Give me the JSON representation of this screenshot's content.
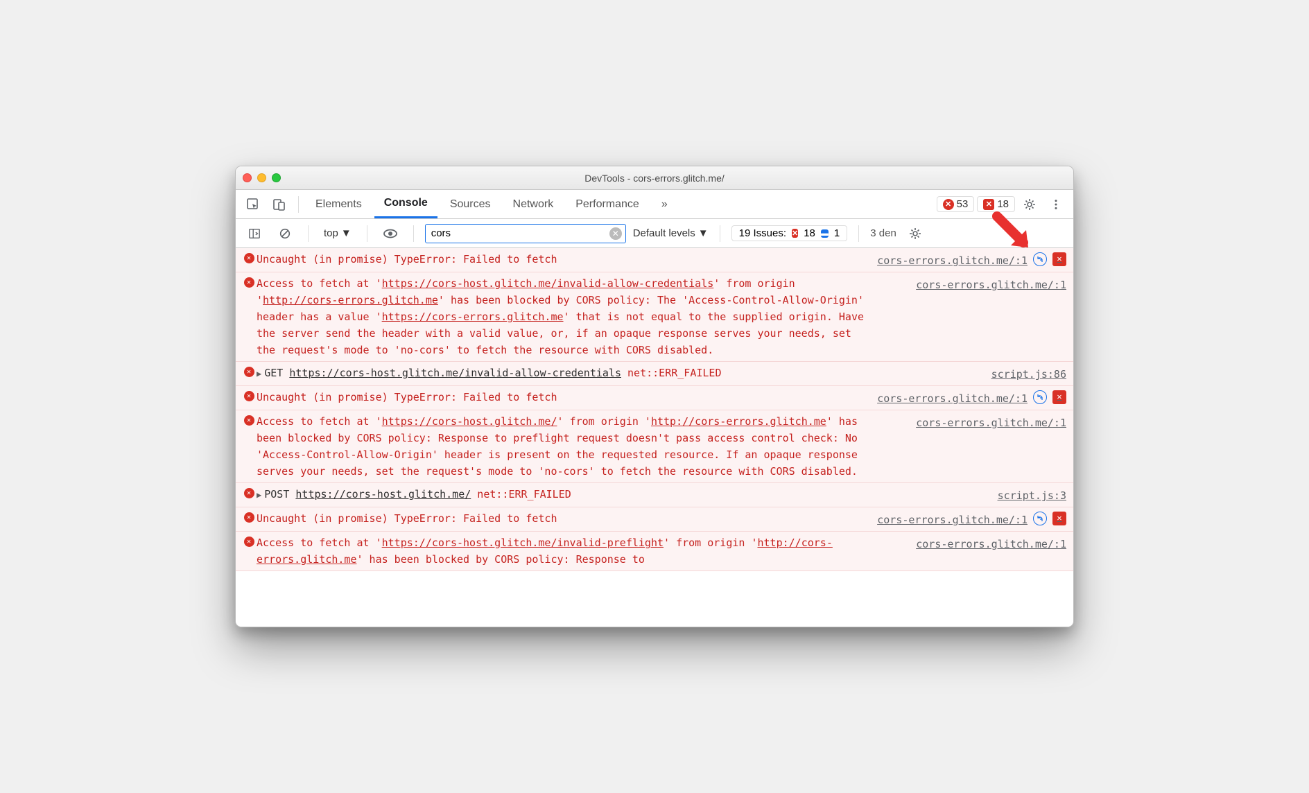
{
  "window": {
    "title": "DevTools - cors-errors.glitch.me/"
  },
  "tabs": {
    "items": [
      "Elements",
      "Console",
      "Sources",
      "Network",
      "Performance"
    ],
    "more": "»",
    "error_count": "53",
    "issue_count": "18"
  },
  "filter": {
    "context": "top",
    "value": "cors",
    "levels": "Default levels",
    "issues_label": "19 Issues:",
    "issues_errors": "18",
    "issues_info": "1",
    "hidden": "3      den"
  },
  "messages": [
    {
      "type": "simple",
      "text": "Uncaught (in promise) TypeError: Failed to fetch",
      "source": "cors-errors.glitch.me/:1",
      "has_net_icon": true,
      "has_issue_icon": true
    },
    {
      "type": "cors",
      "prefix": "Access to fetch at '",
      "url": "https://cors-host.glitch.me/invalid-allow-credentials",
      "mid": "' from origin '",
      "origin": "http://cors-errors.glitch.me",
      "rest": "' has been blocked by CORS policy: The 'Access-Control-Allow-Origin' header has a value '",
      "url2": "https://cors-errors.glitch.me",
      "tail": "' that is not equal to the supplied origin. Have the server send the header with a valid value, or, if an opaque response serves your needs, set the request's mode to 'no-cors' to fetch the resource with CORS disabled.",
      "source": "cors-errors.glitch.me/:1"
    },
    {
      "type": "request",
      "method": "GET",
      "url": "https://cors-host.glitch.me/invalid-allow-credentials",
      "status": "net::ERR_FAILED",
      "source": "script.js:86"
    },
    {
      "type": "simple",
      "text": "Uncaught (in promise) TypeError: Failed to fetch",
      "source": "cors-errors.glitch.me/:1",
      "has_net_icon": true,
      "has_issue_icon": true
    },
    {
      "type": "cors",
      "prefix": "Access to fetch at '",
      "url": "https://cors-host.glitch.me/",
      "mid": "' from origin '",
      "origin": "http://cors-errors.glitch.me",
      "rest": "' has been blocked by CORS policy: Response to preflight request doesn't pass access control check: No 'Access-Control-Allow-Origin' header is present on the requested resource. If an opaque response serves your needs, set the request's mode to 'no-cors' to fetch the resource with CORS disabled.",
      "source": "cors-errors.glitch.me/:1"
    },
    {
      "type": "request",
      "method": "POST",
      "url": "https://cors-host.glitch.me/",
      "status": "net::ERR_FAILED",
      "source": "script.js:3"
    },
    {
      "type": "simple",
      "text": "Uncaught (in promise) TypeError: Failed to fetch",
      "source": "cors-errors.glitch.me/:1",
      "has_net_icon": true,
      "has_issue_icon": true
    },
    {
      "type": "cors",
      "prefix": "Access to fetch at '",
      "url": "https://cors-host.glitch.me/invalid-preflight",
      "mid": "' from origin '",
      "origin": "http://cors-errors.glitch.me",
      "rest": "' has been blocked by CORS policy: Response to",
      "source": "cors-errors.glitch.me/:1",
      "truncated": true
    }
  ]
}
